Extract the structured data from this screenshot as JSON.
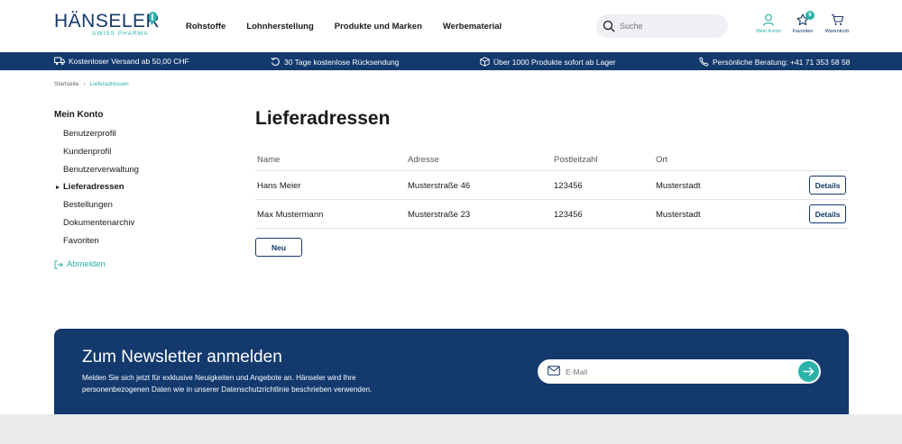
{
  "brand": {
    "name": "HÄNSELER",
    "tagline": "SWISS PHARMA",
    "accent": "#2ab3a8",
    "primary": "#13396d"
  },
  "nav": {
    "items": [
      "Rohstoffe",
      "Lohnherstellung",
      "Produkte und Marken",
      "Werbematerial"
    ]
  },
  "search": {
    "placeholder": "Suche"
  },
  "header_icons": {
    "account": {
      "label": "Mein Konto",
      "icon": "user-icon"
    },
    "favorites": {
      "label": "Favoriten",
      "icon": "star-icon",
      "count": "6"
    },
    "cart": {
      "label": "Warenkorb",
      "icon": "cart-icon"
    }
  },
  "usp": [
    {
      "icon": "truck-icon",
      "text": "Kostenloser Versand ab 50,00 CHF"
    },
    {
      "icon": "return-icon",
      "text": "30 Tage kostenlose Rücksendung"
    },
    {
      "icon": "box-icon",
      "text": "Über 1000 Produkte sofort ab Lager"
    },
    {
      "icon": "phone-icon",
      "text": "Persönliche Beratung: +41 71 353 58 58"
    }
  ],
  "breadcrumb": {
    "home": "Startseite",
    "separator": "›",
    "current": "Lieferadressen"
  },
  "sidebar": {
    "title": "Mein Konto",
    "items": [
      "Benutzerprofil",
      "Kundenprofil",
      "Benutzerverwaltung",
      "Lieferadressen",
      "Bestellungen",
      "Dokumentenarchiv",
      "Favoriten"
    ],
    "active": "Lieferadressen",
    "logout": "Abmelden"
  },
  "main": {
    "title": "Lieferadressen",
    "columns": [
      "Name",
      "Adresse",
      "Postleitzahl",
      "Ort"
    ],
    "rows": [
      {
        "name": "Hans Meier",
        "address": "Musterstraße 46",
        "zip": "123456",
        "city": "Musterstadt",
        "action": "Details"
      },
      {
        "name": "Max Mustermann",
        "address": "Musterstraße 23",
        "zip": "123456",
        "city": "Musterstadt",
        "action": "Details"
      }
    ],
    "new_button": "Neu"
  },
  "newsletter": {
    "title": "Zum Newsletter anmelden",
    "text": "Melden Sie sich jetzt für exklusive Neuigkeiten und Angebote an. Hänseler wird Ihre personenbezogenen Daten wie in unserer Datenschutzrichtlinie beschrieben verwenden.",
    "placeholder": "E-Mail"
  }
}
